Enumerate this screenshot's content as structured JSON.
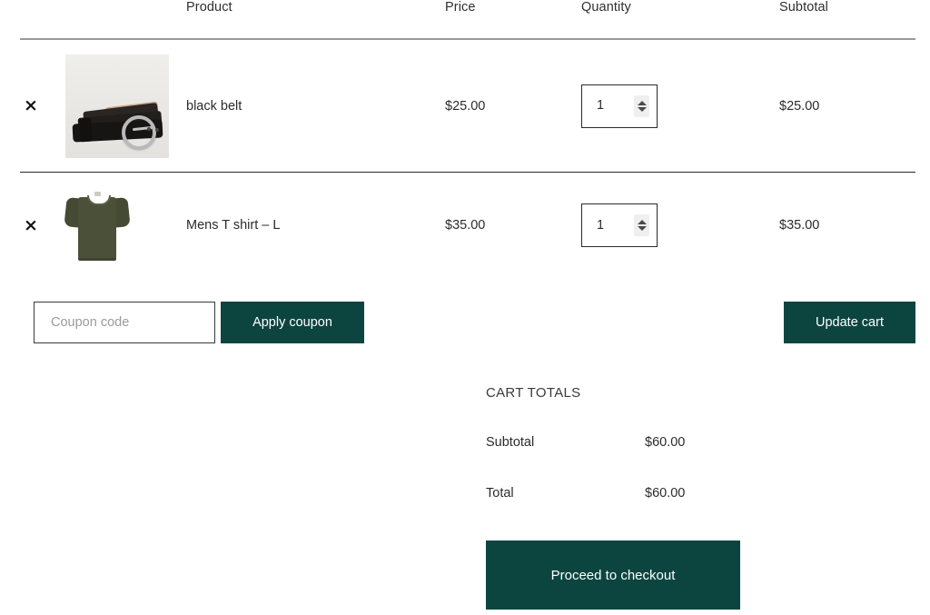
{
  "table": {
    "headers": {
      "remove": "",
      "thumbnail": "",
      "product": "Product",
      "price": "Price",
      "quantity": "Quantity",
      "subtotal": "Subtotal"
    },
    "rows": [
      {
        "remove_label": "×",
        "thumb_name": "black-belt-thumbnail",
        "name": "black belt",
        "price": "$25.00",
        "quantity": "1",
        "subtotal": "$25.00"
      },
      {
        "remove_label": "×",
        "thumb_name": "mens-t-shirt-thumbnail",
        "name": "Mens T shirt – L",
        "price": "$35.00",
        "quantity": "1",
        "subtotal": "$35.00"
      }
    ]
  },
  "coupon": {
    "placeholder": "Coupon code",
    "value": "",
    "apply_label": "Apply coupon"
  },
  "actions": {
    "update_cart_label": "Update cart"
  },
  "totals": {
    "title": "CART TOTALS",
    "lines": [
      {
        "label": "Subtotal",
        "value": "$60.00"
      },
      {
        "label": "Total",
        "value": "$60.00"
      }
    ],
    "checkout_label": "Proceed to checkout"
  },
  "colors": {
    "accent": "#0c4540",
    "text": "#2b2b2b",
    "border": "#2b2b2b",
    "header_rule": "#9a9a9a",
    "placeholder": "#9b9b9b"
  }
}
